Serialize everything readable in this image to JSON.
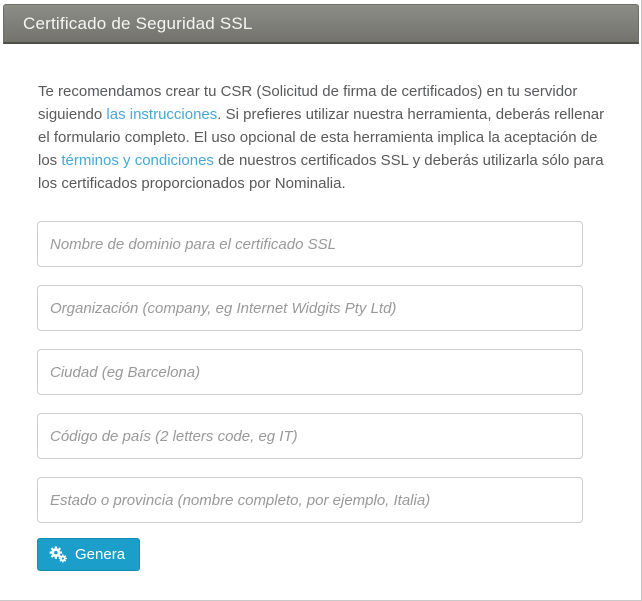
{
  "panel": {
    "title": "Certificado de Seguridad SSL"
  },
  "intro": {
    "part1": "Te recomendamos crear tu CSR (Solicitud de firma de certificados) en tu servidor siguiendo ",
    "link1": "las instrucciones",
    "part2": ". Si prefieres utilizar nuestra herramienta, deberás rellenar el formulario completo. El uso opcional de esta herramienta implica la aceptación de los ",
    "link2": "términos y condiciones",
    "part3": " de nuestros certificados SSL y deberás utilizarla sólo para los certificados proporcionados por Nominalia."
  },
  "form": {
    "fields": [
      {
        "name": "domain",
        "placeholder": "Nombre de dominio para el certificado SSL",
        "value": ""
      },
      {
        "name": "organization",
        "placeholder": "Organización (company, eg Internet Widgits Pty Ltd)",
        "value": ""
      },
      {
        "name": "city",
        "placeholder": "Ciudad (eg Barcelona)",
        "value": ""
      },
      {
        "name": "country_code",
        "placeholder": "Código de país (2 letters code, eg IT)",
        "value": ""
      },
      {
        "name": "state_province",
        "placeholder": "Estado o provincia (nombre completo, por ejemplo, Italia)",
        "value": ""
      }
    ],
    "submit_label": "Genera",
    "submit_icon": "cogs-icon"
  },
  "colors": {
    "header_gradient_top": "#8d8d88",
    "header_gradient_bottom": "#73736c",
    "link": "#45a9d6",
    "body_text": "#58595b",
    "button_background": "#1b9fca",
    "input_border": "#cccccc",
    "placeholder_text": "#999999"
  }
}
